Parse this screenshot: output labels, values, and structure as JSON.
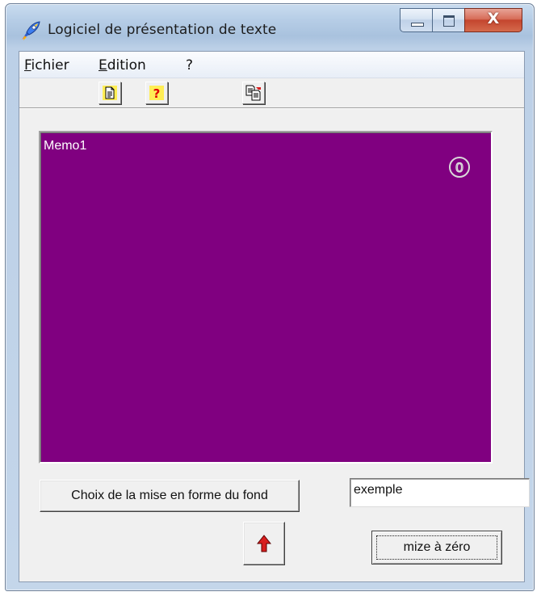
{
  "window": {
    "title": "Logiciel de présentation de texte"
  },
  "menubar": {
    "items": [
      {
        "label": "Fichier",
        "accel": "F",
        "rest": "ichier"
      },
      {
        "label": "Edition",
        "accel": "E",
        "rest": "dition"
      },
      {
        "label": "?",
        "accel": "",
        "rest": "?"
      }
    ]
  },
  "toolbar": {
    "buttons": [
      {
        "icon": "new-document-icon"
      },
      {
        "icon": "help-icon"
      },
      {
        "icon": "copy-paste-icon"
      }
    ]
  },
  "memo": {
    "text": "Memo1",
    "background_color": "#800080",
    "counter_icon": "circled-digit-zero-icon",
    "counter_value": "0"
  },
  "controls": {
    "choose_background_label": "Choix de la mise en forme du fond",
    "edit_value": "exemple",
    "arrow_icon": "red-up-arrow-icon",
    "reset_label": "mize à zéro"
  },
  "colors": {
    "memo_bg": "#800080",
    "arrow": "#d81e1e",
    "help_icon": "#e00000"
  }
}
